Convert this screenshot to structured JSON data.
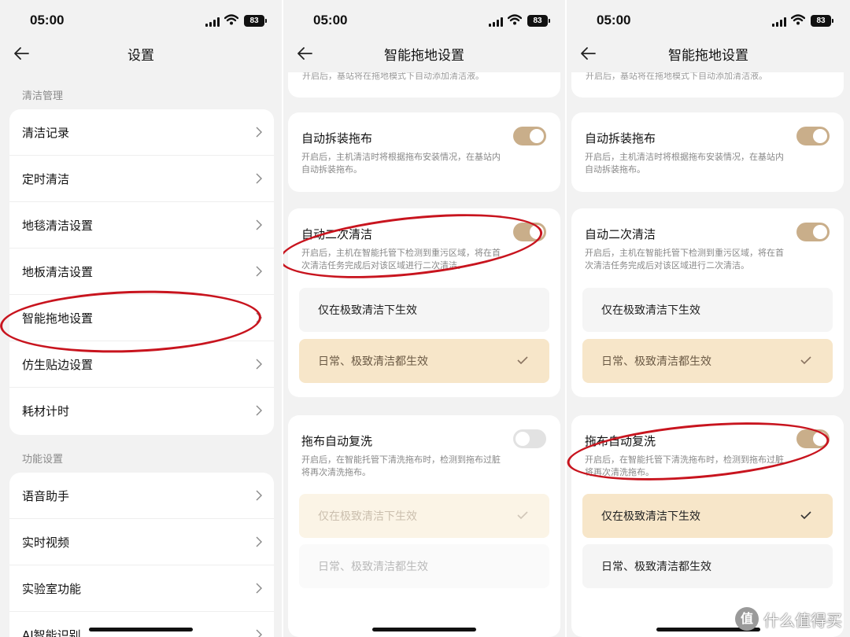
{
  "status": {
    "time": "05:00",
    "battery": "83"
  },
  "screen1": {
    "title": "设置",
    "section1": "清洁管理",
    "items1": [
      "清洁记录",
      "定时清洁",
      "地毯清洁设置",
      "地板清洁设置",
      "智能拖地设置",
      "仿生贴边设置",
      "耗材计时"
    ],
    "section2": "功能设置",
    "items2": [
      "语音助手",
      "实时视频",
      "实验室功能",
      "AI智能识别"
    ]
  },
  "screen2": {
    "title": "智能拖地设置",
    "top_fade": "开启后，基站将在拖地模式下自动添加清洁液。",
    "detach": {
      "title": "自动拆装拖布",
      "desc1": "开启后，主机清洁时将根据拖布安装情况，在基站内",
      "desc2": "自动拆装拖布。",
      "on": true
    },
    "second": {
      "title": "自动二次清洁",
      "desc1": "开启后，主机在智能托管下检测到重污区域，将在首",
      "desc2": "次清洁任务完成后对该区域进行二次清洁。",
      "on": true,
      "opt1": "仅在极致清洁下生效",
      "opt2": "日常、极致清洁都生效",
      "selected": "opt2"
    },
    "rewash": {
      "title": "拖布自动复洗",
      "desc1": "开启后，在智能托管下清洗拖布时，检测到拖布过脏",
      "desc2": "将再次清洗拖布。",
      "on": false,
      "opt1": "仅在极致清洁下生效",
      "opt2": "日常、极致清洁都生效",
      "selected": "opt1"
    }
  },
  "screen3": {
    "title": "智能拖地设置",
    "top_fade": "开启后，基站将在拖地模式下自动添加清洁液。",
    "detach": {
      "title": "自动拆装拖布",
      "desc1": "开启后，主机清洁时将根据拖布安装情况，在基站内",
      "desc2": "自动拆装拖布。",
      "on": true
    },
    "second": {
      "title": "自动二次清洁",
      "desc1": "开启后，主机在智能托管下检测到重污区域，将在首",
      "desc2": "次清洁任务完成后对该区域进行二次清洁。",
      "on": true,
      "opt1": "仅在极致清洁下生效",
      "opt2": "日常、极致清洁都生效",
      "selected": "opt2"
    },
    "rewash": {
      "title": "拖布自动复洗",
      "desc1": "开启后，在智能托管下清洗拖布时，检测到拖布过脏",
      "desc2": "将再次清洗拖布。",
      "on": true,
      "opt1": "仅在极致清洁下生效",
      "opt2": "日常、极致清洁都生效",
      "selected": "opt1"
    }
  },
  "watermark": {
    "badge": "值",
    "text": "什么值得买"
  },
  "colors": {
    "accent": "#c9ae8a",
    "selected_bg": "#f7e6c9",
    "annotation": "#c8141e",
    "card": "#ffffff",
    "page_bg": "#f2f2f2"
  }
}
